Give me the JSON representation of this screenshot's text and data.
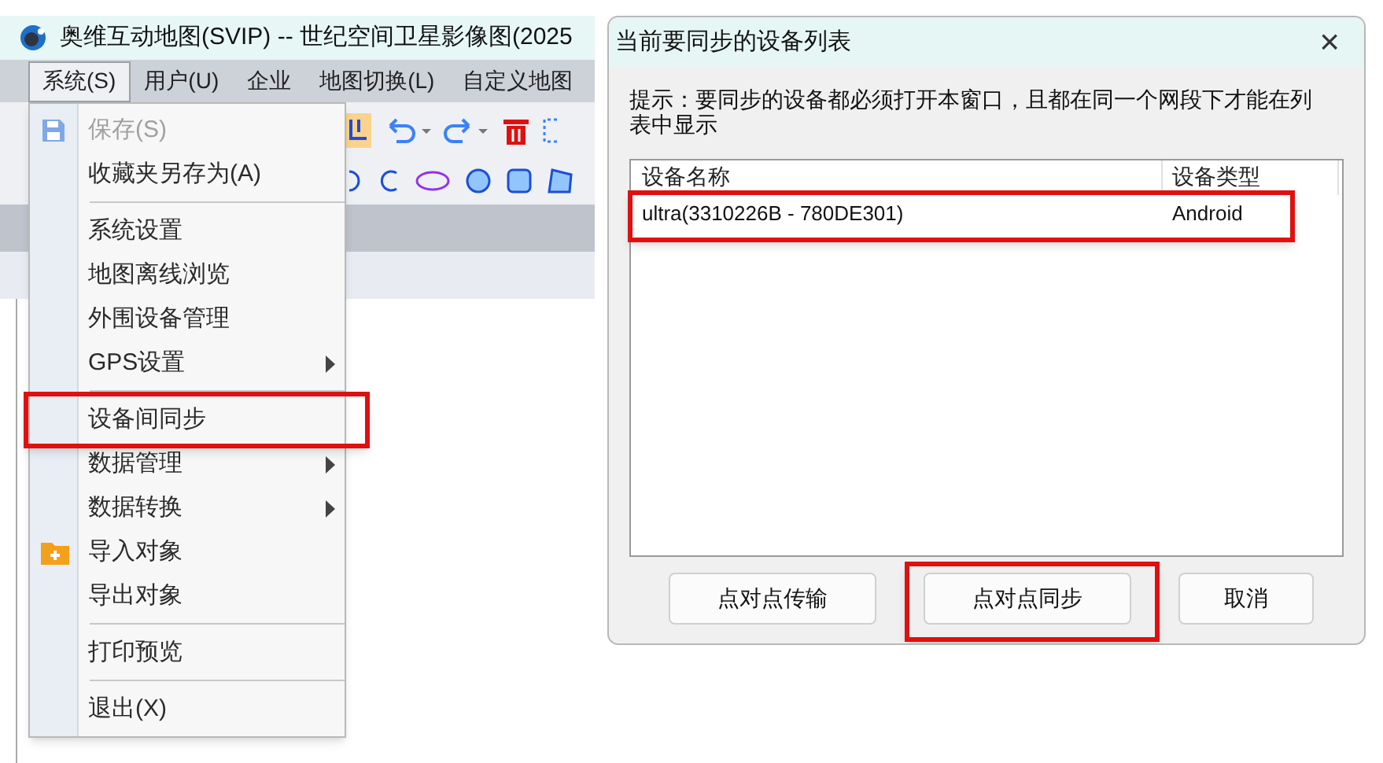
{
  "app": {
    "title": "奥维互动地图(SVIP) -- 世纪空间卫星影像图(2025",
    "menubar": [
      {
        "label": "系统(S)",
        "selected": true
      },
      {
        "label": "用户(U)",
        "selected": false
      },
      {
        "label": "企业",
        "selected": false
      },
      {
        "label": "地图切换(L)",
        "selected": false
      },
      {
        "label": "自定义地图",
        "selected": false
      }
    ],
    "menu": [
      {
        "kind": "item",
        "label": "保存(S)",
        "disabled": true,
        "submenu": false,
        "marked": false
      },
      {
        "kind": "item",
        "label": "收藏夹另存为(A)",
        "disabled": false,
        "submenu": false,
        "marked": false
      },
      {
        "kind": "separator"
      },
      {
        "kind": "item",
        "label": "系统设置",
        "disabled": false,
        "submenu": false,
        "marked": false
      },
      {
        "kind": "item",
        "label": "地图离线浏览",
        "disabled": false,
        "submenu": false,
        "marked": false
      },
      {
        "kind": "item",
        "label": "外围设备管理",
        "disabled": false,
        "submenu": false,
        "marked": false
      },
      {
        "kind": "item",
        "label": "GPS设置",
        "disabled": false,
        "submenu": true,
        "marked": false
      },
      {
        "kind": "separator"
      },
      {
        "kind": "item",
        "label": "设备间同步",
        "disabled": false,
        "submenu": false,
        "marked": true
      },
      {
        "kind": "item",
        "label": "数据管理",
        "disabled": false,
        "submenu": true,
        "marked": false
      },
      {
        "kind": "item",
        "label": "数据转换",
        "disabled": false,
        "submenu": true,
        "marked": false
      },
      {
        "kind": "item",
        "label": "导入对象",
        "disabled": false,
        "submenu": false,
        "marked": false
      },
      {
        "kind": "item",
        "label": "导出对象",
        "disabled": false,
        "submenu": false,
        "marked": false
      },
      {
        "kind": "separator"
      },
      {
        "kind": "item",
        "label": "打印预览",
        "disabled": false,
        "submenu": false,
        "marked": false
      },
      {
        "kind": "separator"
      },
      {
        "kind": "item",
        "label": "退出(X)",
        "disabled": false,
        "submenu": false,
        "marked": false
      }
    ]
  },
  "dialog": {
    "title": "当前要同步的设备列表",
    "close": "×",
    "hint": "提示：要同步的设备都必须打开本窗口，且都在同一个网段下才能在列表中显示",
    "columns": [
      "设备名称",
      "设备类型"
    ],
    "rows": [
      {
        "name": "ultra(3310226B - 780DE301)",
        "type": "Android",
        "marked": true
      }
    ],
    "buttons": [
      {
        "label": "点对点传输",
        "marked": false
      },
      {
        "label": "点对点同步",
        "marked": true
      },
      {
        "label": "取消",
        "marked": false
      }
    ]
  }
}
